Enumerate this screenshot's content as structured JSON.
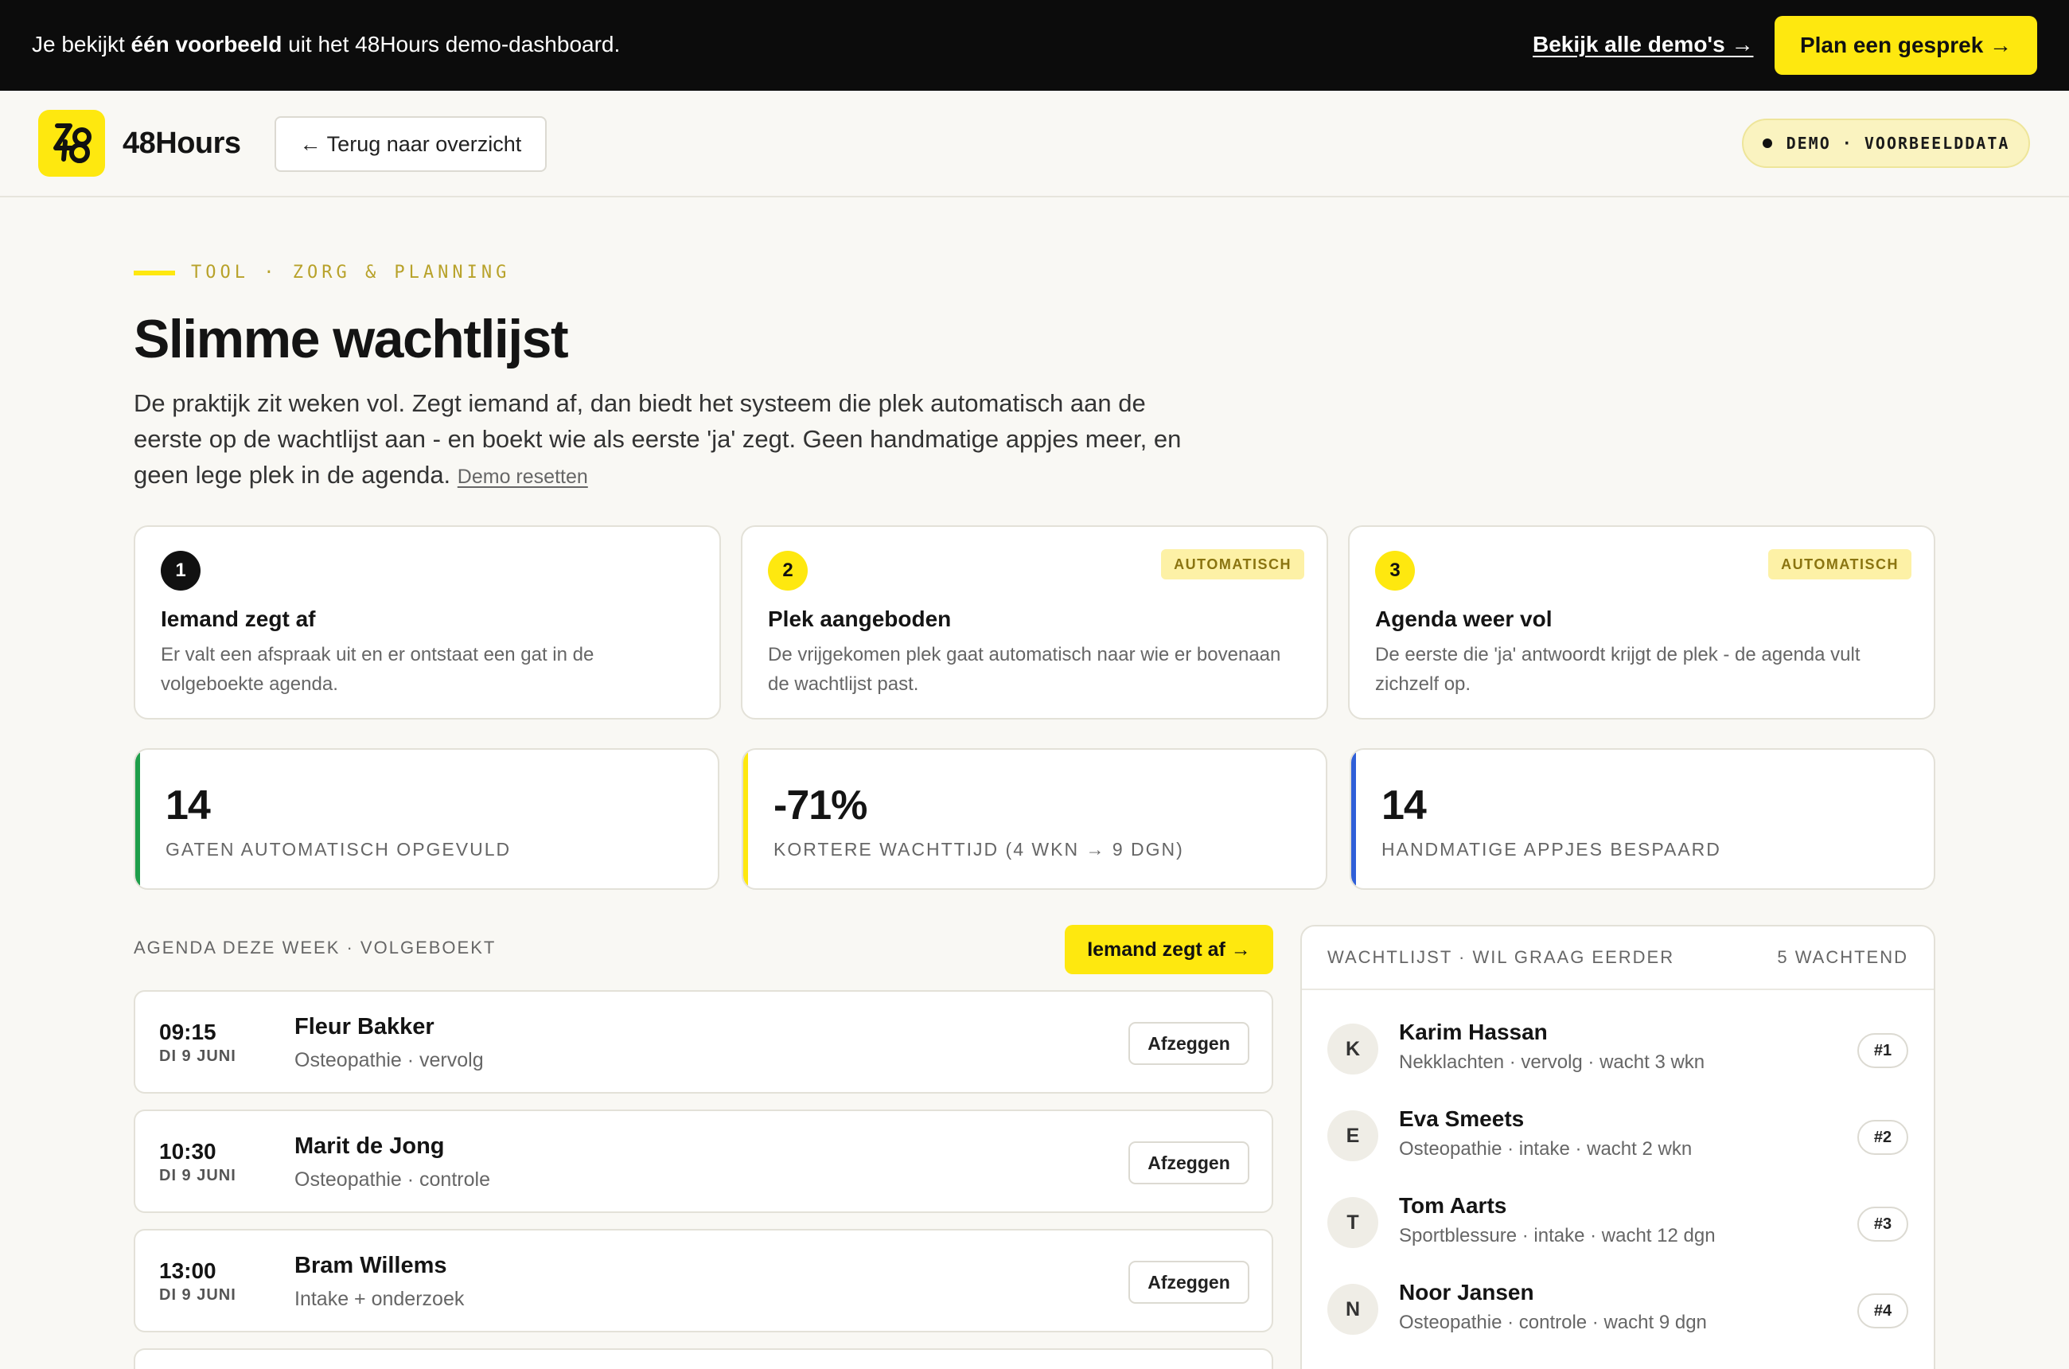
{
  "topbar": {
    "msg_pre": "Je bekijkt ",
    "msg_bold": "één voorbeeld",
    "msg_post": " uit het 48Hours demo-dashboard.",
    "all_demos": "Bekijk alle demo's →",
    "cta": "Plan een gesprek →"
  },
  "header": {
    "logo_icon": "48-logo-icon",
    "brand": "48Hours",
    "back": "← Terug naar overzicht",
    "demo_pill": "DEMO · VOORBEELDDATA"
  },
  "intro": {
    "eyebrow": "TOOL · ZORG & PLANNING",
    "title": "Slimme wachtlijst",
    "description": "De praktijk zit weken vol. Zegt iemand af, dan biedt het systeem die plek automatisch aan de eerste op de wachtlijst aan - en boekt wie als eerste 'ja' zegt. Geen handmatige appjes meer, en geen lege plek in de agenda.",
    "reset": "Demo resetten"
  },
  "steps": [
    {
      "num": "1",
      "badge": "",
      "title": "Iemand zegt af",
      "text": "Er valt een afspraak uit en er ontstaat een gat in de volgeboekte agenda."
    },
    {
      "num": "2",
      "badge": "AUTOMATISCH",
      "title": "Plek aangeboden",
      "text": "De vrijgekomen plek gaat automatisch naar wie er bovenaan de wachtlijst past."
    },
    {
      "num": "3",
      "badge": "AUTOMATISCH",
      "title": "Agenda weer vol",
      "text": "De eerste die 'ja' antwoordt krijgt de plek - de agenda vult zichzelf op."
    }
  ],
  "stats": [
    {
      "value": "14",
      "label": "GATEN AUTOMATISCH OPGEVULD",
      "accent": "#1e9e4a"
    },
    {
      "value": "-71%",
      "label": "KORTERE WACHTTIJD (4 WKN → 9 DGN)",
      "accent": "#fee80f"
    },
    {
      "value": "14",
      "label": "HANDMATIGE APPJES BESPAARD",
      "accent": "#2f5fd8"
    }
  ],
  "agenda": {
    "label": "AGENDA DEZE WEEK · VOLGEBOEKT",
    "cancel_button": "Iemand zegt af →",
    "cancel_label": "Afzeggen",
    "appointments": [
      {
        "time": "09:15",
        "day": "DI 9 JUNI",
        "name": "Fleur Bakker",
        "type": "Osteopathie · vervolg"
      },
      {
        "time": "10:30",
        "day": "DI 9 JUNI",
        "name": "Marit de Jong",
        "type": "Osteopathie · controle"
      },
      {
        "time": "13:00",
        "day": "DI 9 JUNI",
        "name": "Bram Willems",
        "type": "Intake + onderzoek"
      }
    ]
  },
  "waitlist": {
    "title": "WACHTLIJST · WIL GRAAG EERDER",
    "count": "5 WACHTEND",
    "items": [
      {
        "initial": "K",
        "name": "Karim Hassan",
        "meta": "Nekklachten · vervolg · wacht 3 wkn",
        "rank": "#1"
      },
      {
        "initial": "E",
        "name": "Eva Smeets",
        "meta": "Osteopathie · intake · wacht 2 wkn",
        "rank": "#2"
      },
      {
        "initial": "T",
        "name": "Tom Aarts",
        "meta": "Sportblessure · intake · wacht 12 dgn",
        "rank": "#3"
      },
      {
        "initial": "N",
        "name": "Noor Jansen",
        "meta": "Osteopathie · controle · wacht 9 dgn",
        "rank": "#4"
      }
    ]
  },
  "colors": {
    "brand_yellow": "#fee80f",
    "dark": "#0c0c0c"
  }
}
